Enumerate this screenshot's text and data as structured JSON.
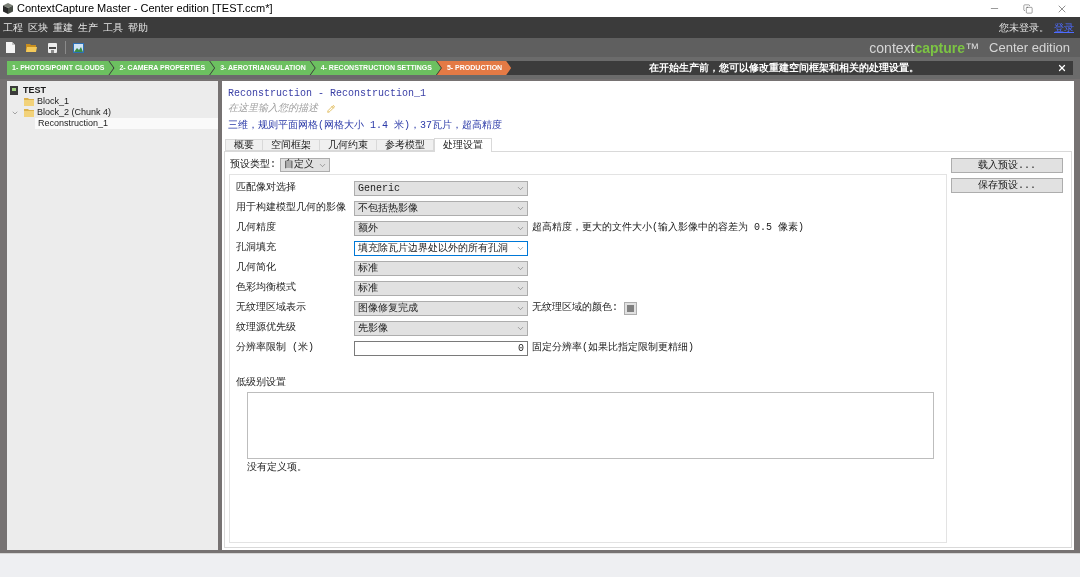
{
  "window": {
    "title": "ContextCapture Master - Center edition [TEST.ccm*]"
  },
  "menu": {
    "items": [
      "工程",
      "区块",
      "重建",
      "生产",
      "工具",
      "帮助"
    ],
    "login_status": "您未登录。",
    "login_link": "登录"
  },
  "toolbar": {
    "logo": "context**capture**™",
    "edition": "Center edition"
  },
  "workflow": {
    "steps": [
      {
        "label": "1- PHOTOS/POINT CLOUDS",
        "selected": false
      },
      {
        "label": "2- CAMERA PROPERTIES",
        "selected": false
      },
      {
        "label": "3- AEROTRIANGULATION",
        "selected": false
      },
      {
        "label": "4- RECONSTRUCTION SETTINGS",
        "selected": false
      },
      {
        "label": "5- PRODUCTION",
        "selected": true
      }
    ],
    "message": "在开始生产前，您可以修改重建空间框架和相关的处理设置。"
  },
  "tree": [
    {
      "kind": "project",
      "label": "TEST",
      "selected": false,
      "children": [
        {
          "kind": "block",
          "label": "Block_1",
          "selected": false,
          "expanded": false
        },
        {
          "kind": "block",
          "label": "Block_2 (Chunk 4)",
          "selected": false,
          "expanded": true,
          "children": [
            {
              "kind": "reconstruction",
              "label": "Reconstruction_1",
              "selected": true
            }
          ]
        }
      ]
    }
  ],
  "reconstruction": {
    "title": "Reconstruction - Reconstruction_1",
    "description": {
      "placeholder": "在这里输入您的描述"
    },
    "summary": "三维，规则平面网格(网格大小 1.4 米)，37瓦片，超高精度",
    "tabs": [
      {
        "label": "概要",
        "selected": false
      },
      {
        "label": "空间框架",
        "selected": false
      },
      {
        "label": "几何约束",
        "selected": false
      },
      {
        "label": "参考模型",
        "selected": false
      },
      {
        "label": "处理设置",
        "selected": true
      }
    ],
    "preset": {
      "label": "预设类型:",
      "value": "自定义"
    },
    "preset_buttons": [
      "载入预设...",
      "保存预设..."
    ],
    "settings": [
      {
        "kind": "select",
        "label": "匹配像对选择",
        "value": "Generic",
        "focused": false
      },
      {
        "kind": "select",
        "label": "用于构建模型几何的影像",
        "value": "不包括热影像",
        "focused": false
      },
      {
        "kind": "select",
        "label": "几何精度",
        "value": "额外",
        "focused": false,
        "hint": "超高精度，更大的文件大小(输入影像中的容差为 0.5 像素)"
      },
      {
        "kind": "select",
        "label": "孔洞填充",
        "value": "填充除瓦片边界处以外的所有孔洞",
        "focused": true
      },
      {
        "kind": "select",
        "label": "几何简化",
        "value": "标准",
        "focused": false
      },
      {
        "kind": "select",
        "label": "色彩均衡模式",
        "value": "标准",
        "focused": false
      },
      {
        "kind": "select",
        "label": "无纹理区域表示",
        "value": "图像修复完成",
        "focused": false,
        "hint": "无纹理区域的颜色:",
        "color": "#808080"
      },
      {
        "kind": "select",
        "label": "纹理源优先级",
        "value": "先影像",
        "focused": false
      },
      {
        "kind": "input",
        "label": "分辨率限制 (米)",
        "value": "0",
        "focused": false,
        "hint": "固定分辨率(如果比指定限制更精细)"
      }
    ],
    "low_level": {
      "label": "低级别设置",
      "empty_text": "没有定义项。"
    }
  }
}
